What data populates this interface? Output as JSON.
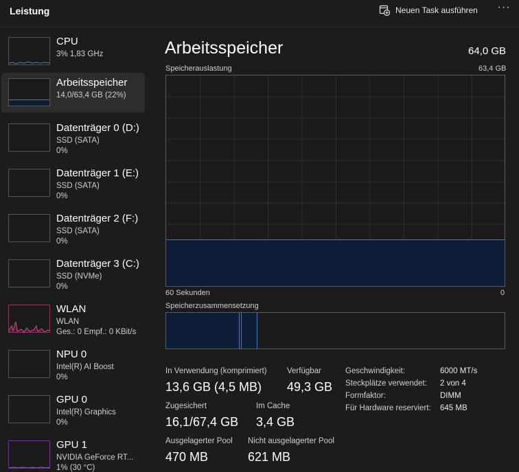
{
  "header": {
    "title": "Leistung",
    "new_task_label": "Neuen Task ausführen",
    "more_label": "···"
  },
  "sidebar": {
    "items": [
      {
        "name": "CPU",
        "line2": "3%  1,83 GHz",
        "line3": "",
        "selected": false
      },
      {
        "name": "Arbeitsspeicher",
        "line2": "14,0/63,4 GB (22%)",
        "line3": "",
        "selected": true
      },
      {
        "name": "Datenträger 0 (D:)",
        "line2": "SSD (SATA)",
        "line3": "0%",
        "selected": false
      },
      {
        "name": "Datenträger 1 (E:)",
        "line2": "SSD (SATA)",
        "line3": "0%",
        "selected": false
      },
      {
        "name": "Datenträger 2 (F:)",
        "line2": "SSD (SATA)",
        "line3": "0%",
        "selected": false
      },
      {
        "name": "Datenträger 3 (C:)",
        "line2": "SSD (NVMe)",
        "line3": "0%",
        "selected": false
      },
      {
        "name": "WLAN",
        "line2": "WLAN",
        "line3": "Ges.: 0 Empf.: 0 KBit/s",
        "selected": false
      },
      {
        "name": "NPU 0",
        "line2": "Intel(R) AI Boost",
        "line3": "0%",
        "selected": false
      },
      {
        "name": "GPU 0",
        "line2": "Intel(R) Graphics",
        "line3": "0%",
        "selected": false
      },
      {
        "name": "GPU 1",
        "line2": "NVIDIA GeForce RT...",
        "line3": "1%  (30 °C)",
        "selected": false
      }
    ]
  },
  "main": {
    "title": "Arbeitsspeicher",
    "total": "64,0 GB",
    "usage_label": "Speicherauslastung",
    "usage_max": "63,4 GB",
    "time_label": "60 Sekunden",
    "time_min": "0",
    "composition_label": "Speicherzusammensetzung",
    "usage_fraction": 0.22,
    "stats": {
      "in_use_label": "In Verwendung (komprimiert)",
      "in_use_value": "13,6 GB (4,5 MB)",
      "available_label": "Verfügbar",
      "available_value": "49,3 GB",
      "committed_label": "Zugesichert",
      "committed_value": "16,1/67,4 GB",
      "cached_label": "Im Cache",
      "cached_value": "3,4 GB",
      "paged_label": "Ausgelagerter Pool",
      "paged_value": "470 MB",
      "nonpaged_label": "Nicht ausgelagerter Pool",
      "nonpaged_value": "621 MB"
    },
    "info": [
      {
        "key": "Geschwindigkeit:",
        "value": "6000 MT/s"
      },
      {
        "key": "Steckplätze verwendet:",
        "value": "2 von 4"
      },
      {
        "key": "Formfaktor:",
        "value": "DIMM"
      },
      {
        "key": "Für Hardware reserviert:",
        "value": "645 MB"
      }
    ]
  },
  "colors": {
    "background": "#1c1c1c",
    "memory_accent": "#4a78c8",
    "memory_fill": "#0e1d36",
    "wlan_accent": "#c8508a"
  }
}
